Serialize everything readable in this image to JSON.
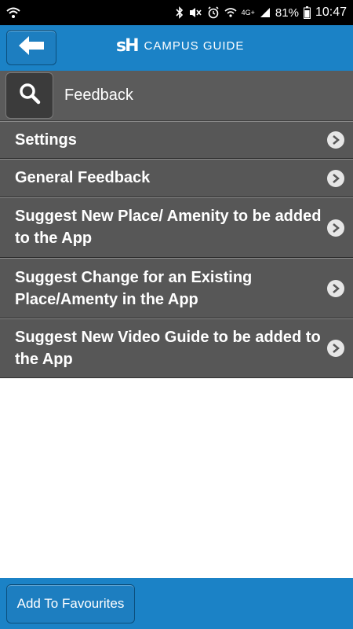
{
  "status_bar": {
    "battery": "81%",
    "time": "10:47",
    "network": "4G+"
  },
  "header": {
    "logo_mark": "sH",
    "title": "CAMPUS GUIDE"
  },
  "search": {
    "title": "Feedback"
  },
  "list": {
    "items": [
      {
        "label": "Settings"
      },
      {
        "label": "General Feedback"
      },
      {
        "label": "Suggest New Place/ Amenity to be added to the App"
      },
      {
        "label": "Suggest Change for an Existing Place/Amenty in the App"
      },
      {
        "label": "Suggest New Video Guide to be added to the App"
      }
    ]
  },
  "footer": {
    "add_favourites_label": "Add To Favourites"
  },
  "colors": {
    "header_blue": "#1b82c6",
    "list_bg": "#575757",
    "search_bg": "#5b5b5b"
  },
  "icons": [
    "wifi-icon",
    "bluetooth-icon",
    "mute-icon",
    "alarm-icon",
    "signal-icon",
    "battery-icon",
    "back-arrow-icon",
    "search-icon",
    "chevron-right-icon"
  ]
}
